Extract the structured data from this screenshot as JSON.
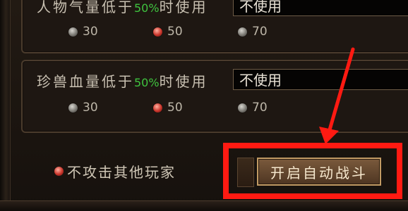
{
  "groups": [
    {
      "label_prefix": "人物气量低于",
      "label_pct": "50%",
      "label_suffix": "时使用",
      "select_value": "不使用",
      "options": [
        {
          "label": "30",
          "selected": false
        },
        {
          "label": "50",
          "selected": true
        },
        {
          "label": "70",
          "selected": false
        }
      ]
    },
    {
      "label_prefix": "珍兽血量低于",
      "label_pct": "50%",
      "label_suffix": "时使用",
      "select_value": "不使用",
      "options": [
        {
          "label": "30",
          "selected": false
        },
        {
          "label": "50",
          "selected": true
        },
        {
          "label": "70",
          "selected": false
        }
      ]
    }
  ],
  "no_attack_label": "不攻击其他玩家",
  "start_button_label": "开启自动战斗",
  "colors": {
    "highlight": "#ff1a12",
    "percent": "#3fc43f",
    "panel": "#1e1712"
  }
}
